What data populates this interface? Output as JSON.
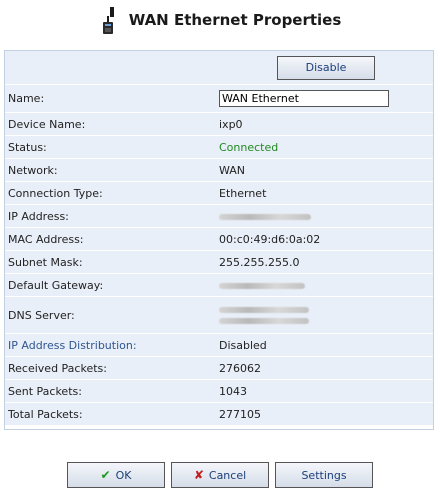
{
  "header": {
    "title": "WAN Ethernet Properties"
  },
  "actions": {
    "disable_label": "Disable"
  },
  "fields": {
    "name": {
      "label": "Name:",
      "value": "WAN Ethernet"
    },
    "device_name": {
      "label": "Device Name:",
      "value": "ixp0"
    },
    "status": {
      "label": "Status:",
      "value": "Connected"
    },
    "network": {
      "label": "Network:",
      "value": "WAN"
    },
    "connection_type": {
      "label": "Connection Type:",
      "value": "Ethernet"
    },
    "ip_address": {
      "label": "IP Address:"
    },
    "mac_address": {
      "label": "MAC Address:",
      "value": "00:c0:49:d6:0a:02"
    },
    "subnet_mask": {
      "label": "Subnet Mask:",
      "value": "255.255.255.0"
    },
    "default_gateway": {
      "label": "Default Gateway:"
    },
    "dns_server": {
      "label": "DNS Server:"
    },
    "ip_distribution": {
      "label": "IP Address Distribution:",
      "value": "Disabled"
    },
    "received_packets": {
      "label": "Received Packets:",
      "value": "276062"
    },
    "sent_packets": {
      "label": "Sent Packets:",
      "value": "1043"
    },
    "total_packets": {
      "label": "Total Packets:",
      "value": "277105"
    }
  },
  "footer": {
    "ok_label": "OK",
    "cancel_label": "Cancel",
    "settings_label": "Settings"
  },
  "colors": {
    "status_connected": "#1f8a1f",
    "panel_row": "#e9eff8",
    "link_blue": "#2f5590"
  }
}
